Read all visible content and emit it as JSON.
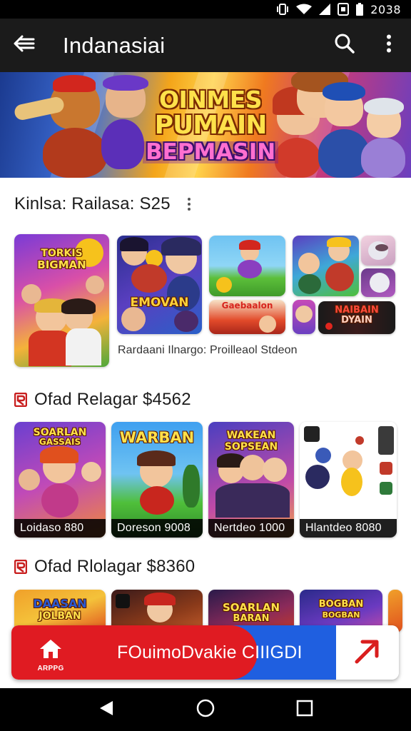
{
  "status_bar": {
    "time": "2038"
  },
  "app_bar": {
    "title": "Indanasiai",
    "icons": {
      "back": "back-arrow-icon",
      "search": "search-icon",
      "more": "more-vert-icon"
    }
  },
  "banner": {
    "logo_line1": "OINMES",
    "logo_line2": "PUMAIN",
    "logo_line3": "BEPMASIN"
  },
  "sections": [
    {
      "title": "Kinlsa: Railasa: S25",
      "sub_caption": "Rardaani Ilnargo: Proilleaol Stdeon",
      "cards": [
        {
          "title_line1": "TORKIS",
          "title_line2": "BIGMAN"
        },
        {
          "title_line1": "EMOVAN",
          "title_line2": ""
        },
        {
          "title_line1": "",
          "title_line2": ""
        },
        {
          "title_line1": "Gaebaalon",
          "title_line2": ""
        },
        {
          "title_line1": "",
          "title_line2": ""
        },
        {
          "title_line1": "",
          "title_line2": ""
        },
        {
          "title_line1": "",
          "title_line2": ""
        },
        {
          "title_line1": "NAIBAIN",
          "title_line2": "DYAIN"
        }
      ]
    },
    {
      "title": "Ofad Relagar $4562",
      "cards": [
        {
          "title_line1": "SOARLAN",
          "title_line2": "GASSAIS",
          "caption": "Loidaso   880"
        },
        {
          "title_line1": "WARBAN",
          "title_line2": "",
          "caption": "Doreson   9008"
        },
        {
          "title_line1": "WAKEAN",
          "title_line2": "SOPSEAN",
          "caption": "Nertdeo   1000"
        },
        {
          "title_line1": "",
          "title_line2": "",
          "caption": "Hlantdeo   8080"
        }
      ]
    },
    {
      "title": "Ofad Rlolagar $8360",
      "cards": [
        {
          "title_line1": "DAASAN",
          "title_line2": "JOLBAN"
        },
        {
          "title_line1": "",
          "title_line2": ""
        },
        {
          "title_line1": "SOARLAN",
          "title_line2": "BARAN"
        },
        {
          "title_line1": "BOGBAN",
          "title_line2": "BOGBAN"
        }
      ]
    }
  ],
  "cta": {
    "home_label": "ARPPG",
    "text": "FOuimoDvakie CIIIGDI",
    "icons": {
      "home": "home-icon",
      "arrow": "arrow-icon"
    }
  },
  "nav_bar": {
    "icons": {
      "back": "nav-back-icon",
      "home": "nav-home-icon",
      "recents": "nav-recents-icon"
    }
  },
  "colors": {
    "app_bar": "#1b1b1b",
    "cta_red": "#e01b22",
    "cta_blue": "#1f5fe0"
  }
}
